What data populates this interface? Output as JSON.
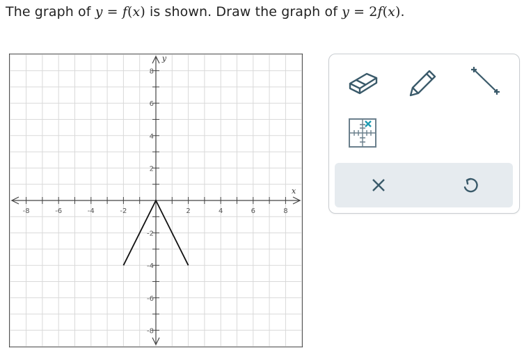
{
  "prompt": {
    "part1": "The graph of ",
    "y": "y",
    "eq": " = ",
    "f": "f",
    "lparen": "(",
    "x": "x",
    "rparen": ")",
    "part2": " is shown. Draw the graph of ",
    "y2": "y",
    "eq2": " = 2",
    "f2": "f",
    "lparen2": "(",
    "x2": "x",
    "rparen2": ")",
    "end": "."
  },
  "graph": {
    "x_axis_label": "x",
    "y_axis_label": "y",
    "x_range": [
      -9,
      9
    ],
    "y_range": [
      -9,
      9
    ],
    "x_ticks": [
      "-8",
      "-6",
      "-4",
      "-2",
      "2",
      "4",
      "6",
      "8"
    ],
    "y_ticks": [
      "8",
      "6",
      "4",
      "2",
      "-2",
      "-4",
      "-6",
      "-8"
    ],
    "curve_points": [
      [
        -2,
        -4
      ],
      [
        0,
        0
      ],
      [
        2,
        -4
      ]
    ],
    "line_color": "#111111",
    "grid_color": "#d9d9d9"
  },
  "toolbar": {
    "tools": [
      "eraser-icon",
      "pencil-icon",
      "line-segment-icon",
      "point-grid-icon"
    ],
    "accent_color": "#3a5a6a",
    "actions": [
      "clear-icon",
      "undo-icon"
    ]
  }
}
